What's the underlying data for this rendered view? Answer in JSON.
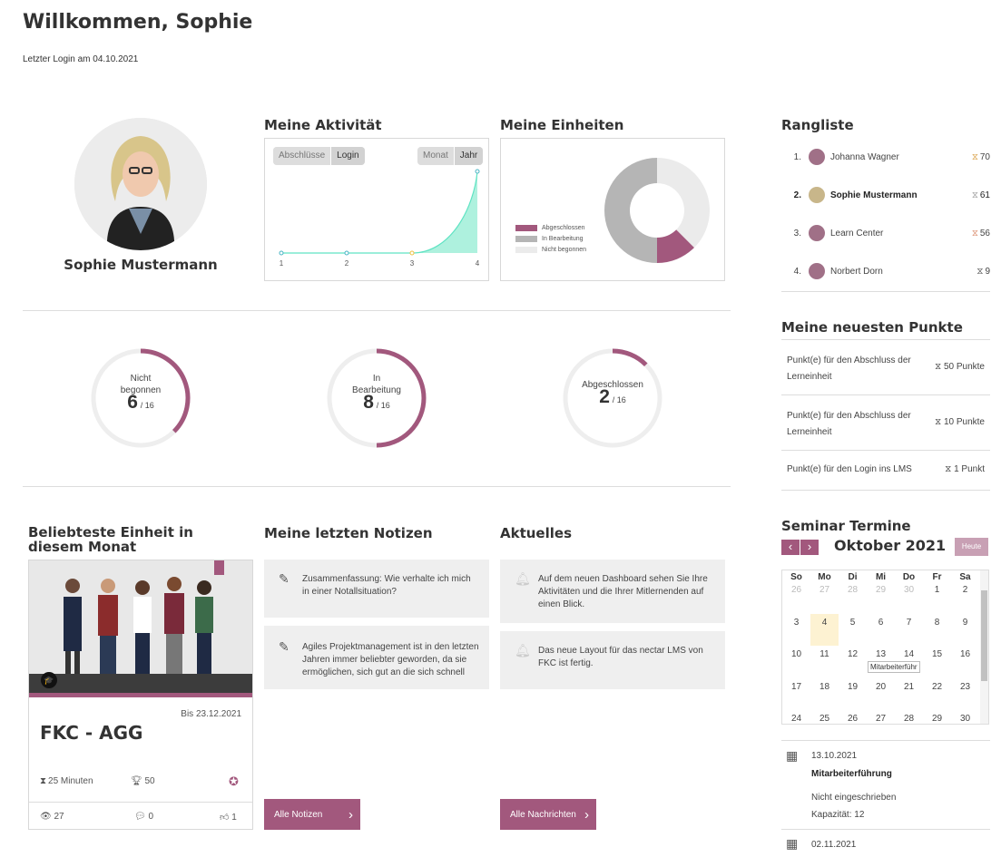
{
  "header": {
    "welcome": "Willkommen, Sophie",
    "last_login": "Letzter Login am 04.10.2021"
  },
  "profile": {
    "name": "Sophie Mustermann"
  },
  "activity": {
    "title": "Meine Aktivität",
    "toggle_left": [
      "Abschlüsse",
      "Login"
    ],
    "toggle_right": [
      "Monat",
      "Jahr"
    ],
    "active_left": "Login",
    "active_right": "Jahr"
  },
  "units": {
    "title": "Meine Einheiten",
    "legend": [
      "Abgeschlossen",
      "In Bearbeitung",
      "Nicht begonnen"
    ]
  },
  "chart_data": [
    {
      "type": "area",
      "x": [
        1,
        2,
        3,
        4
      ],
      "values": [
        0,
        0,
        0,
        100
      ],
      "xticks": [
        "1",
        "2",
        "3",
        "4"
      ],
      "color": "#5fe3c3"
    },
    {
      "type": "pie",
      "donut": true,
      "categories": [
        "Abgeschlossen",
        "In Bearbeitung",
        "Nicht begonnen"
      ],
      "values": [
        2,
        8,
        6
      ],
      "colors": [
        "#a2587d",
        "#b5b5b5",
        "#ebebeb"
      ]
    }
  ],
  "progress": [
    {
      "label_line1": "Nicht",
      "label_line2": "begonnen",
      "value": "6",
      "total": "/ 16",
      "fraction": 0.375
    },
    {
      "label_line1": "In",
      "label_line2": "Bearbeitung",
      "value": "8",
      "total": "/ 16",
      "fraction": 0.5
    },
    {
      "label_line1": "Abgeschlossen",
      "label_line2": "",
      "value": "2",
      "total": "/ 16",
      "fraction": 0.125
    }
  ],
  "popular": {
    "title": "Beliebteste Einheit in diesem Monat",
    "due": "Bis 23.12.2021",
    "name": "FKC - AGG",
    "duration": "25 Minuten",
    "points": "50",
    "views": "27",
    "comments": "0",
    "likes": "1"
  },
  "notes": {
    "title": "Meine letzten Notizen",
    "items": [
      "Zusammenfassung: Wie verhalte ich mich in einer Notallsituation?",
      "Agiles Projektmanagement ist in den letzten Jahren immer beliebter geworden, da sie ermöglichen, sich gut an die sich schnell"
    ],
    "button": "Alle Notizen"
  },
  "news": {
    "title": "Aktuelles",
    "items": [
      "Auf dem neuen Dashboard sehen Sie Ihre Aktivitäten und die Ihrer Mitlernenden auf einen Blick.",
      "Das neue Layout für das nectar LMS von FKC ist fertig."
    ],
    "button": "Alle Nachrichten"
  },
  "ranking": {
    "title": "Rangliste",
    "items": [
      {
        "rank": "1.",
        "name": "Johanna Wagner",
        "points": "70"
      },
      {
        "rank": "2.",
        "name": "Sophie Mustermann",
        "points": "61"
      },
      {
        "rank": "3.",
        "name": "Learn Center",
        "points": "56"
      },
      {
        "rank": "4.",
        "name": "Norbert Dorn",
        "points": "9"
      }
    ]
  },
  "latest_points": {
    "title": "Meine neuesten Punkte",
    "items": [
      {
        "text": "Punkt(e) für den Abschluss der Lerneinheit",
        "points": "50 Punkte"
      },
      {
        "text": "Punkt(e) für den Abschluss der Lerneinheit",
        "points": "10 Punkte"
      },
      {
        "text": "Punkt(e) für den Login ins LMS",
        "points": "1 Punkt"
      }
    ]
  },
  "seminars": {
    "title": "Seminar Termine",
    "month": "Oktober 2021",
    "today_button": "Heute",
    "weekdays": [
      "So",
      "Mo",
      "Di",
      "Mi",
      "Do",
      "Fr",
      "Sa"
    ],
    "weeks": [
      [
        "26",
        "27",
        "28",
        "29",
        "30",
        "1",
        "2"
      ],
      [
        "3",
        "4",
        "5",
        "6",
        "7",
        "8",
        "9"
      ],
      [
        "10",
        "11",
        "12",
        "13",
        "14",
        "15",
        "16"
      ],
      [
        "17",
        "18",
        "19",
        "20",
        "21",
        "22",
        "23"
      ],
      [
        "24",
        "25",
        "26",
        "27",
        "28",
        "29",
        "30"
      ]
    ],
    "event_label": "Mitarbeiterführ",
    "events": [
      {
        "date": "13.10.2021",
        "title": "Mitarbeiterführung",
        "status": "Nicht eingeschrieben",
        "capacity": "Kapazität: 12"
      },
      {
        "date": "02.11.2021"
      }
    ]
  }
}
